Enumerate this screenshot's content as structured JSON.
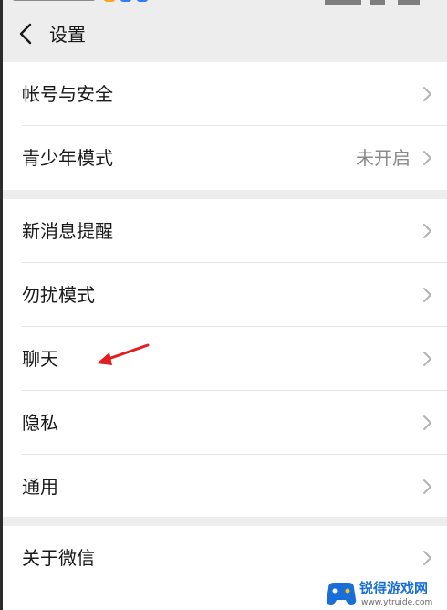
{
  "navbar": {
    "title": "设置",
    "back_icon": "chevron-left-icon"
  },
  "groups": [
    {
      "items": [
        {
          "label": "帐号与安全",
          "value": ""
        },
        {
          "label": "青少年模式",
          "value": "未开启"
        }
      ]
    },
    {
      "items": [
        {
          "label": "新消息提醒",
          "value": ""
        },
        {
          "label": "勿扰模式",
          "value": ""
        },
        {
          "label": "聊天",
          "value": ""
        },
        {
          "label": "隐私",
          "value": ""
        },
        {
          "label": "通用",
          "value": ""
        }
      ]
    },
    {
      "items": [
        {
          "label": "关于微信",
          "value": ""
        }
      ]
    }
  ],
  "annotation": {
    "icon": "red-arrow-icon",
    "color": "#e02020"
  },
  "watermark": {
    "title": "锐得游戏网",
    "url": "www.ytruide.com",
    "accent": "#1a6ed8"
  },
  "colors": {
    "background": "#ededed",
    "cell": "#ffffff",
    "text": "#191919",
    "secondary": "#8a8a8a"
  }
}
